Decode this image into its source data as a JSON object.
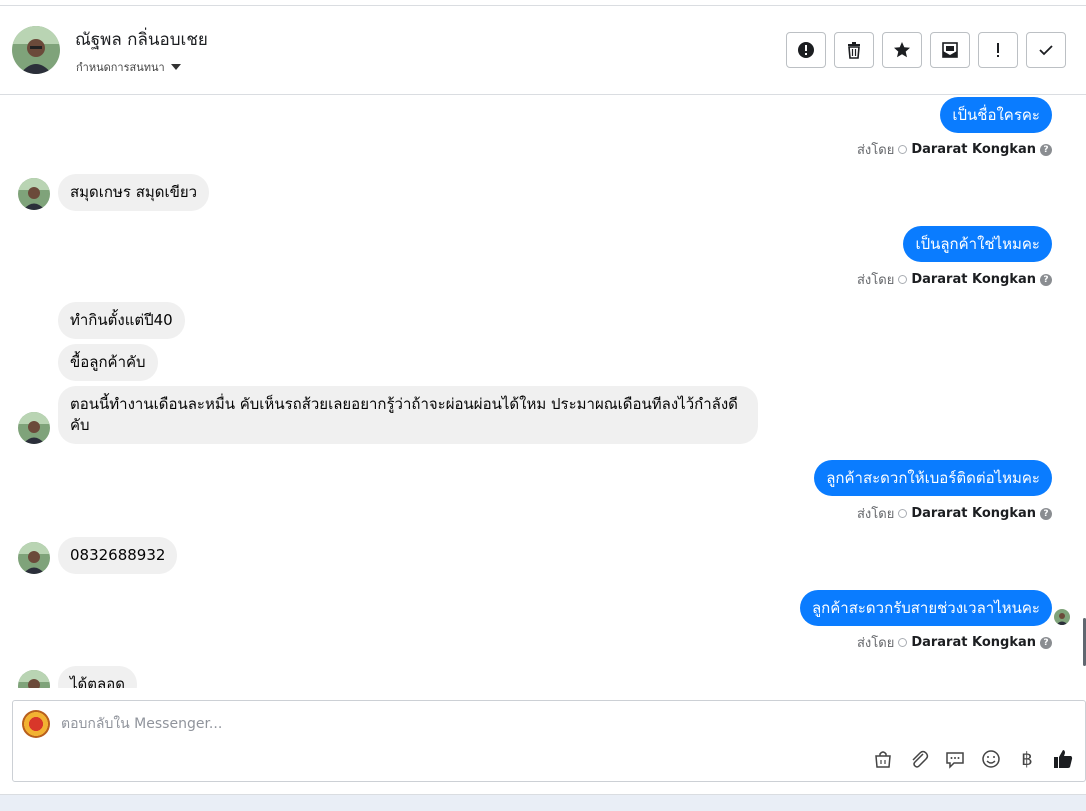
{
  "header": {
    "name": "ณัฐพล กลิ่นอบเชย",
    "subtitle": "กำหนดการสนทนา",
    "tools": [
      "spam-report-icon",
      "trash-icon",
      "star-icon",
      "mark-unread-icon",
      "important-icon",
      "done-check-icon"
    ]
  },
  "messages": {
    "m1": "เป็นชื่อใครคะ",
    "m2": "สมุดเกษร  สมุดเขียว",
    "m3": "เป็นลูกค้าใช่ไหมคะ",
    "m4": "ทำกินตั้งแต่ปี40",
    "m5": "ขื้อลูกค้าคับ",
    "m6": "ตอนนี้ทำงานเดือนละหมื่น คับเห็นรถส้วยเลยอยากรู้ว่าถ้าจะผ่อนผ่อนได้ใหม ประมาผณเดือนทีลงไว้กำลังดีคับ",
    "m7": "ลูกค้าสะดวกให้เบอร์ติดต่อไหมคะ",
    "m8": "0832688932",
    "m9": "ลูกค้าสะดวกรับสายช่วงเวลาไหนคะ",
    "m10": "ได้ตลอด"
  },
  "sent_by": {
    "label": "ส่งโดย",
    "agent": "Dararat Kongkan",
    "help": "?"
  },
  "composer": {
    "placeholder": "ตอบกลับใน Messenger...",
    "currency_symbol": "฿"
  },
  "colors": {
    "outgoing_bubble": "#0a7cff",
    "incoming_bubble": "#f0f0f0"
  }
}
